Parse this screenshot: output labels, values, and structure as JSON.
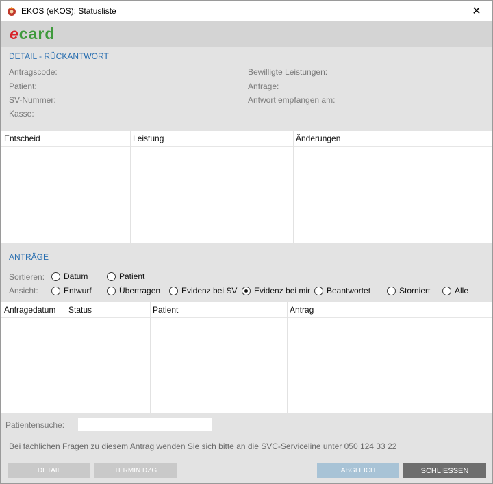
{
  "window": {
    "title": "EKOS (eKOS): Statusliste",
    "close_label": "✕"
  },
  "logo": {
    "e": "e",
    "rest": "card"
  },
  "detail": {
    "section_title": "DETAIL - RÜCKANTWORT",
    "left_fields": [
      "Antragscode:",
      "Patient:",
      "SV-Nummer:",
      "Kasse:"
    ],
    "right_fields": [
      "Bewilligte Leistungen:",
      "Anfrage:",
      "Antwort empfangen am:"
    ],
    "table_headers": [
      "Entscheid",
      "Leistung",
      "Änderungen"
    ]
  },
  "antraege": {
    "section_title": "ANTRÄGE",
    "sort_label": "Sortieren:",
    "sort_options": [
      "Datum",
      "Patient"
    ],
    "view_label": "Ansicht:",
    "view_options": [
      "Entwurf",
      "Übertragen",
      "Evidenz bei SV",
      "Evidenz bei mir",
      "Beantwortet",
      "Storniert",
      "Alle"
    ],
    "view_selected": "Evidenz bei mir",
    "table_headers": [
      "Anfragedatum",
      "Status",
      "Patient",
      "Antrag"
    ]
  },
  "search": {
    "label": "Patientensuche:",
    "value": ""
  },
  "info_text": "Bei fachlichen Fragen zu diesem Antrag wenden Sie sich bitte an die SVC-Serviceline unter 050 124 33 22",
  "buttons": {
    "detail": "DETAIL",
    "termin": "TERMIN DZG",
    "abgleich": "ABGLEICH",
    "schliessen": "SCHLIESSEN"
  },
  "colors": {
    "accent": "#2a6fb0",
    "logo_red": "#d8232a",
    "logo_green": "#3f9a3c",
    "btn_disabled": "#c8c8c8",
    "btn_blue": "#a8c3d6",
    "btn_dark": "#6e6e6e"
  }
}
